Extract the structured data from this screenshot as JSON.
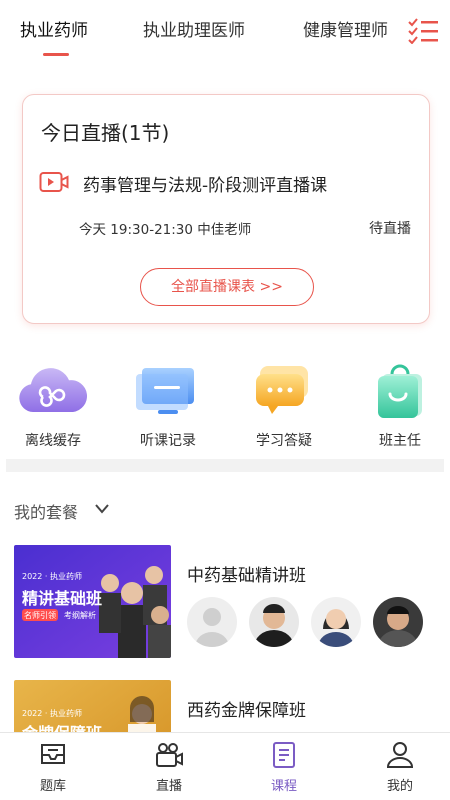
{
  "tabs": [
    {
      "label": "执业药师",
      "active": true
    },
    {
      "label": "执业助理医师",
      "active": false
    },
    {
      "label": "健康管理师",
      "active": false
    }
  ],
  "live": {
    "title": "今日直播(1节)",
    "course": "药事管理与法规-阶段测评直播课",
    "time": "今天 19:30-21:30 中佳老师",
    "status": "待直播",
    "all_button": "全部直播课表 >>"
  },
  "quick_actions": [
    {
      "label": "离线缓存",
      "icon": "cloud-icon"
    },
    {
      "label": "听课记录",
      "icon": "monitor-icon"
    },
    {
      "label": "学习答疑",
      "icon": "chat-bubble-icon"
    },
    {
      "label": "班主任",
      "icon": "shopping-bag-icon"
    }
  ],
  "packages_section": {
    "title": "我的套餐"
  },
  "packages": [
    {
      "name": "中药基础精讲班",
      "thumb": {
        "year_tag": "2022 · 执业药师",
        "headline": "精讲基础班",
        "badge": "名师引领",
        "sub": "考纲解析"
      }
    },
    {
      "name": "西药金牌保障班",
      "thumb": {
        "year_tag": "2022 · 执业药师",
        "headline": "金牌保障班"
      }
    }
  ],
  "bottom_nav": [
    {
      "label": "题库",
      "active": false
    },
    {
      "label": "直播",
      "active": false
    },
    {
      "label": "课程",
      "active": true
    },
    {
      "label": "我的",
      "active": false
    }
  ],
  "colors": {
    "accent": "#e8544b",
    "nav_active": "#7b5cc4",
    "thumb_purple": "#5a3fd0",
    "thumb_gold": "#e0a93a"
  }
}
